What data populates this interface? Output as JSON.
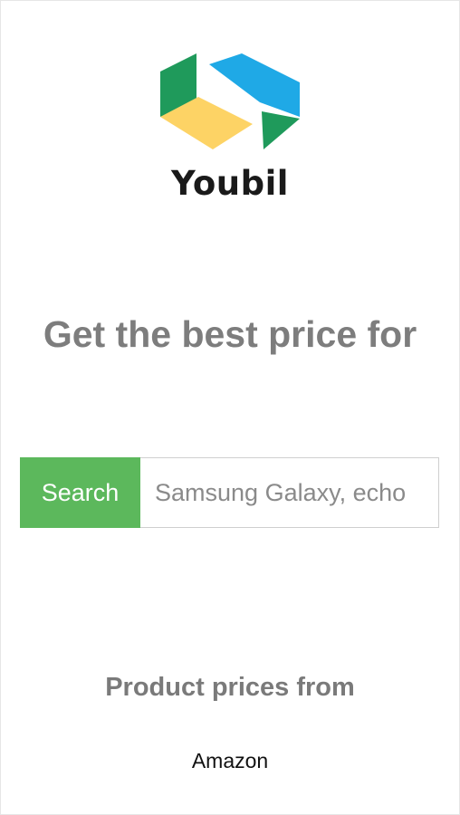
{
  "brand": {
    "name": "Youbil",
    "logo_icon": "youbil-hexagon-logo-icon",
    "logo_colors": {
      "green": "#1f9a5b",
      "blue": "#1fa9e6",
      "yellow": "#fdd365"
    }
  },
  "hero": {
    "headline": "Get the best price for"
  },
  "search": {
    "button_label": "Search",
    "placeholder": "Samsung Galaxy, echo",
    "value": "",
    "button_color": "#5cb85c"
  },
  "sources": {
    "heading": "Product prices from",
    "items": [
      "Amazon"
    ]
  }
}
